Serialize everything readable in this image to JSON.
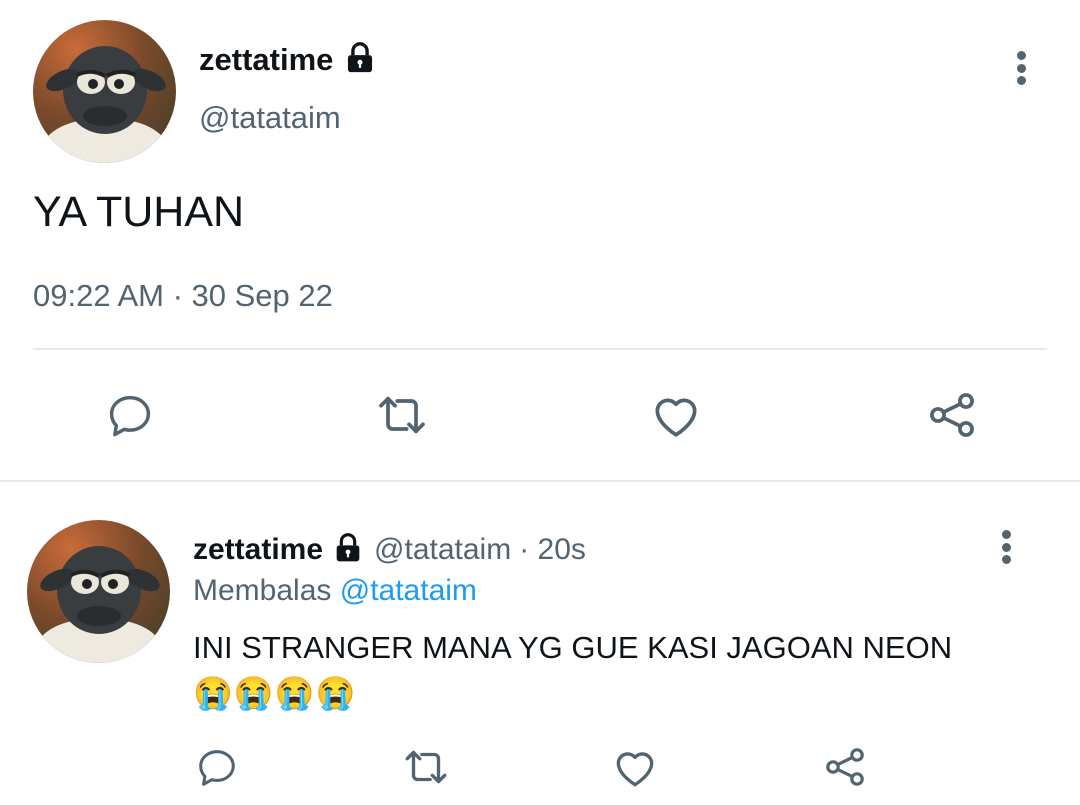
{
  "main_tweet": {
    "display_name": "zettatime",
    "handle": "@tatataim",
    "text": "YA TUHAN",
    "timestamp": "09:22 AM · 30 Sep 22"
  },
  "reply_tweet": {
    "display_name": "zettatime",
    "handle": "@tatataim",
    "time_ago": "· 20s",
    "replying_label": "Membalas",
    "replying_handle": "@tatataim",
    "text": "INI STRANGER MANA YG GUE KASI JAGOAN NEON",
    "emoji": "😭😭😭😭"
  },
  "icons": {
    "reply": "reply-icon",
    "retweet": "retweet-icon",
    "like": "like-icon",
    "share": "share-icon",
    "lock": "lock-icon",
    "more": "more-options-icon"
  },
  "colors": {
    "text": "#0f1419",
    "muted": "#536471",
    "link": "#1d9bf0",
    "divider": "#e6e9eb"
  }
}
